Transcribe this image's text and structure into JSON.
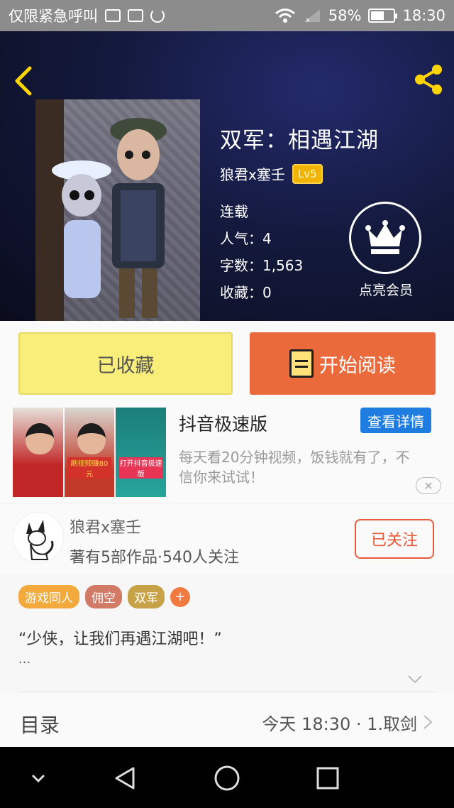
{
  "status_bar": {
    "carrier": "仅限紧急呼叫",
    "battery": "58%",
    "battery_level": 0.58,
    "time": "18:30"
  },
  "book": {
    "title": "双军：相遇江湖",
    "author": "狼君x塞壬",
    "level": "Lv5",
    "status": "连载",
    "popularity": "人气：4",
    "word_count": "字数：1,563",
    "favorites": "收藏：0",
    "vip_label": "点亮会员"
  },
  "actions": {
    "favorited_label": "已收藏",
    "read_label": "开始阅读"
  },
  "ad": {
    "title": "抖音极速版",
    "detail_button": "查看详情",
    "description": "每天看20分钟视频，饭钱就有了，不信你来试试！",
    "panel_captions": [
      "",
      "刷视频赚80元",
      "打开抖音极速版"
    ],
    "close": "✕"
  },
  "author_info": {
    "name": "狼君x塞壬",
    "stats": "著有5部作品·540人关注",
    "follow_label": "已关注"
  },
  "tags": [
    {
      "label": "游戏同人",
      "color": "#f3a93b"
    },
    {
      "label": "佣空",
      "color": "#d17a66"
    },
    {
      "label": "双军",
      "color": "#c7a246"
    }
  ],
  "tag_add": "+",
  "intro": {
    "text": "“少侠，让我们再遇江湖吧！”",
    "more": "..."
  },
  "toc": {
    "title": "目录",
    "latest": "今天 18:30 · 1.取剑"
  },
  "colors": {
    "accent_orange": "#eb6a3b",
    "fav_yellow": "#faee7a",
    "ad_blue": "#1f7de2"
  }
}
